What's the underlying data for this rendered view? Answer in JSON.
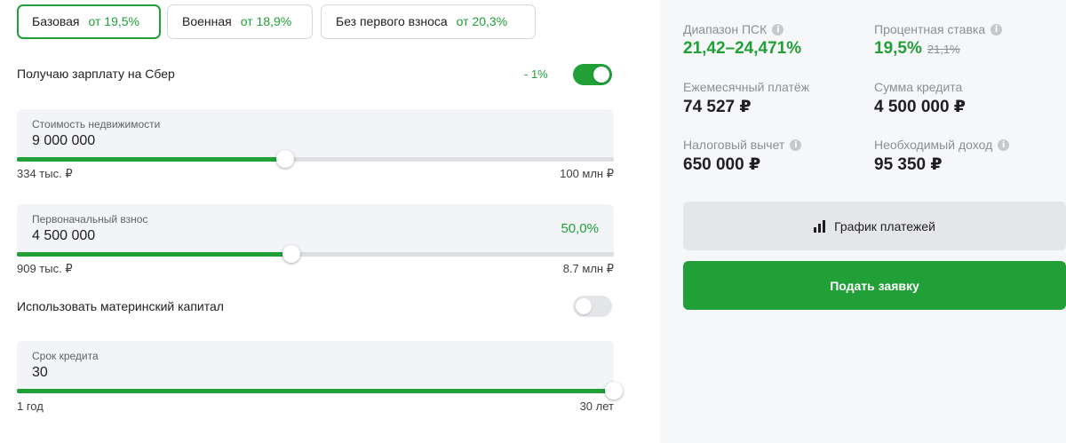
{
  "tabs": [
    {
      "label": "Базовая",
      "rate": "от 19,5%"
    },
    {
      "label": "Военная",
      "rate": "от 18,9%"
    },
    {
      "label": "Без первого взноса",
      "rate": "от 20,3%"
    }
  ],
  "salary": {
    "label": "Получаю зарплату на Сбер",
    "discount": "- 1%",
    "enabled": true
  },
  "property_cost": {
    "label": "Стоимость недвижимости",
    "value": "9 000 000",
    "min": "334 тыс. ₽",
    "max": "100 млн ₽",
    "slider_fraction": 0.45
  },
  "down_payment": {
    "label": "Первоначальный взнос",
    "value": "4 500 000",
    "percent": "50,0%",
    "min": "909 тыс. ₽",
    "max": "8.7 млн ₽",
    "slider_fraction": 0.46
  },
  "maternity": {
    "label": "Использовать материнский капитал",
    "enabled": false
  },
  "term": {
    "label": "Срок кредита",
    "value": "30",
    "min": "1 год",
    "max": "30 лет",
    "slider_fraction": 1.0
  },
  "summary": {
    "psk": {
      "label": "Диапазон ПСК",
      "value": "21,42–24,471%"
    },
    "rate": {
      "label": "Процентная ставка",
      "value": "19,5%",
      "old_value": "21,1%"
    },
    "monthly": {
      "label": "Ежемесячный платёж",
      "value": "74 527 ₽"
    },
    "loan": {
      "label": "Сумма кредита",
      "value": "4 500 000 ₽"
    },
    "tax": {
      "label": "Налоговый вычет",
      "value": "650 000 ₽"
    },
    "income": {
      "label": "Необходимый доход",
      "value": "95 350 ₽"
    }
  },
  "buttons": {
    "schedule": "График платежей",
    "apply": "Подать заявку"
  },
  "icons": {
    "info": "info-icon",
    "schedule": "bar-chart-icon"
  },
  "colors": {
    "accent": "#21a038",
    "panel": "#f6f7f8"
  }
}
